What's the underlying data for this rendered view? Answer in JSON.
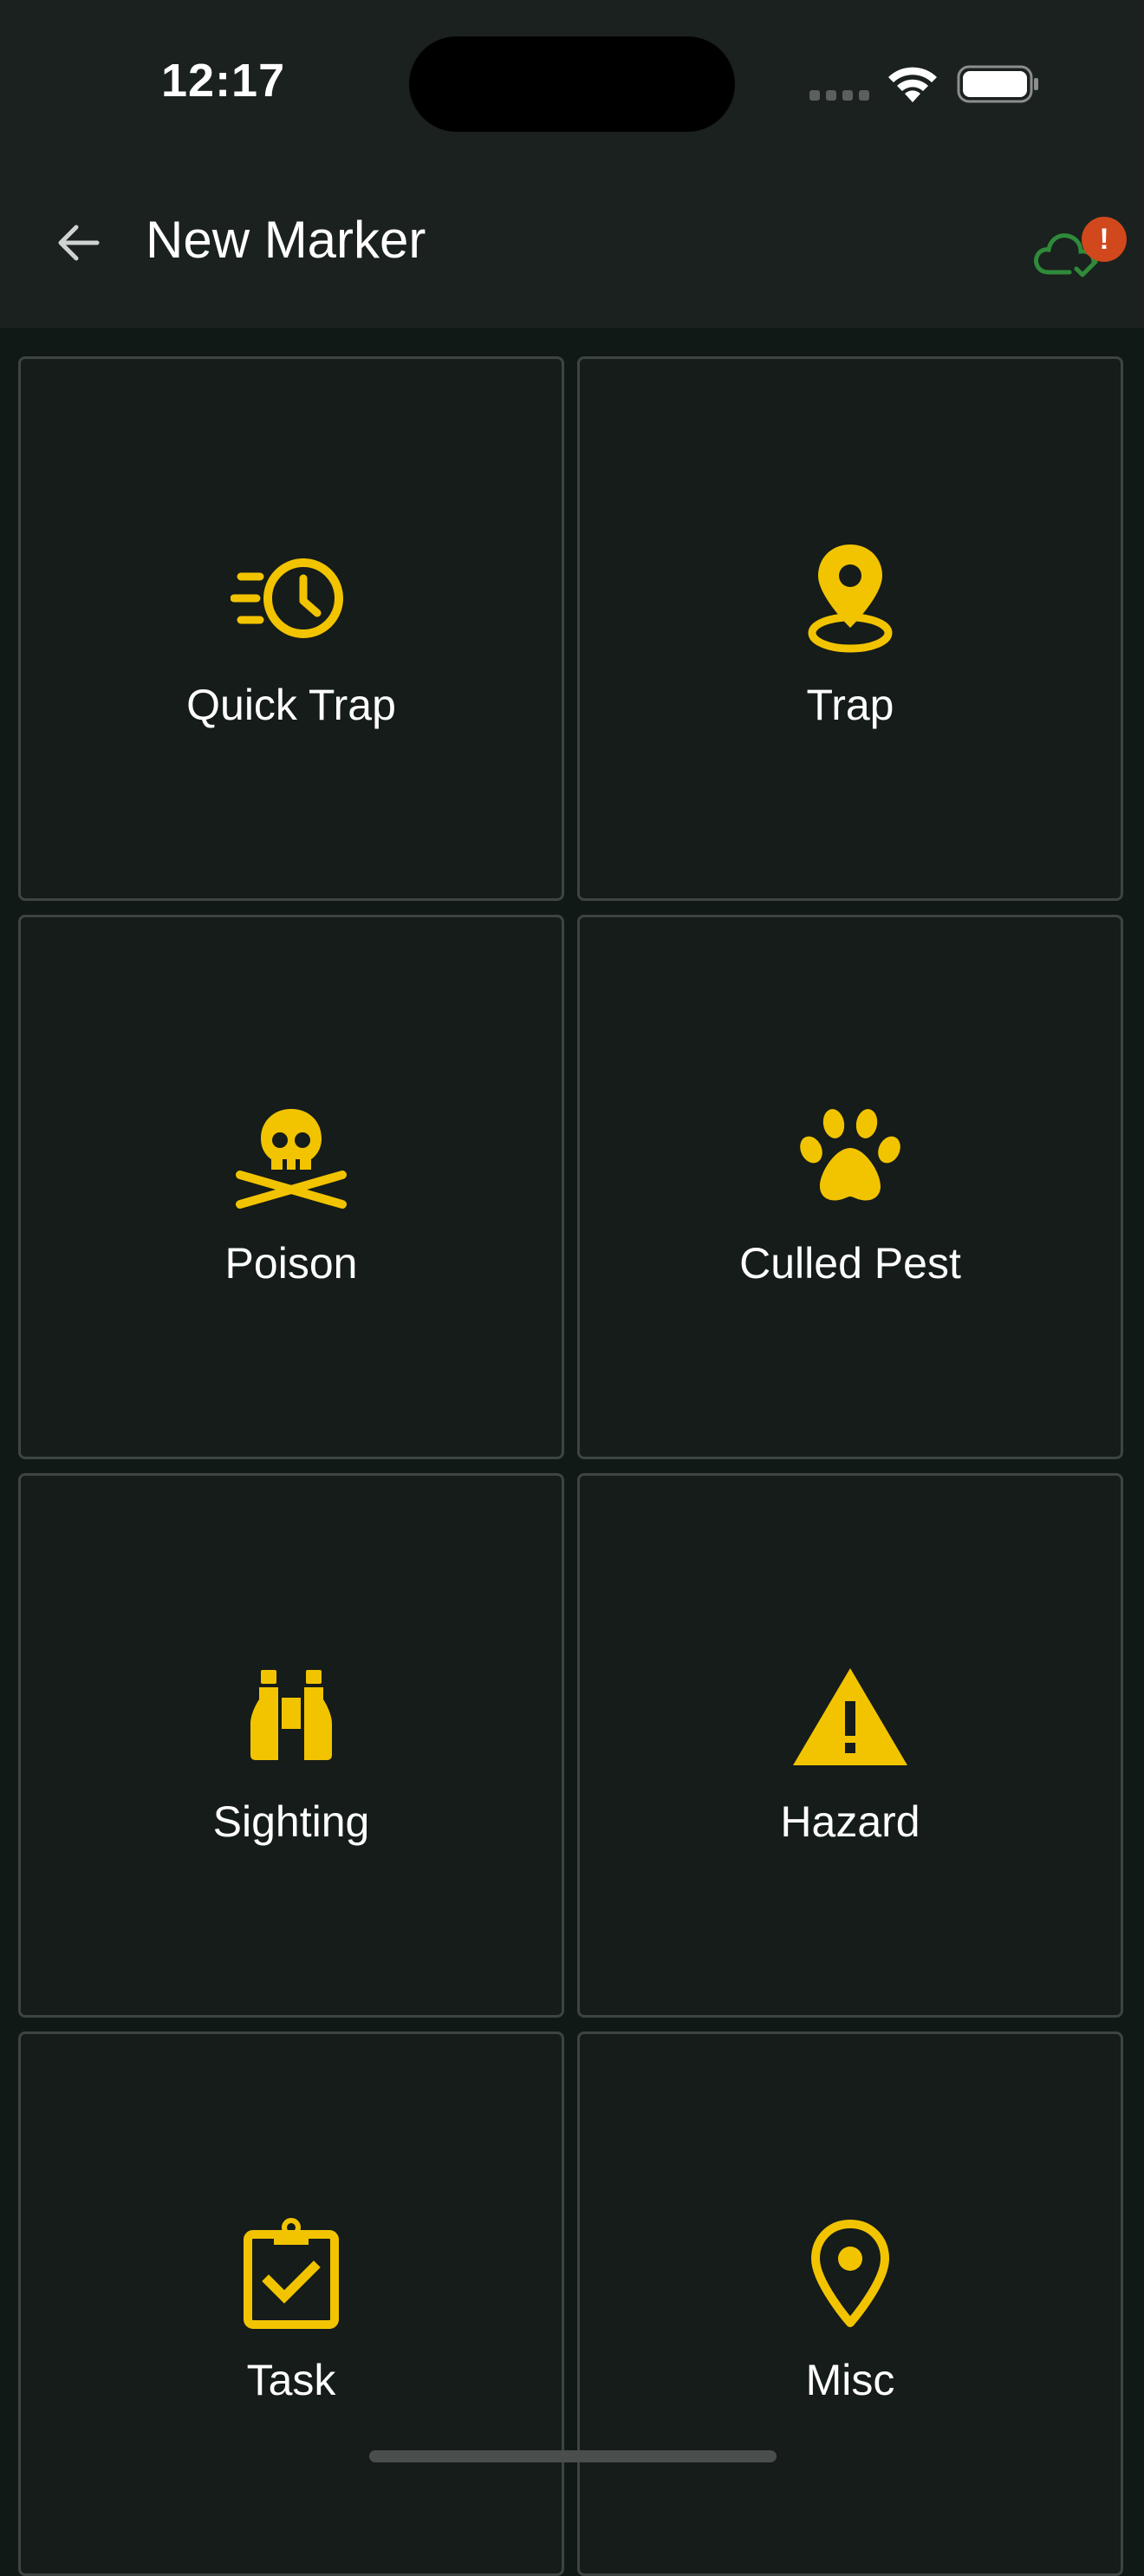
{
  "status_bar": {
    "time": "12:17"
  },
  "app_bar": {
    "title": "New Marker",
    "back_icon": "arrow-left-icon",
    "sync_icon": "cloud-check-icon",
    "sync_badge": "!"
  },
  "colors": {
    "accent": "#f2c400",
    "background": "#111916",
    "tile": "#151c19",
    "tile_border": "#3c4541",
    "app_bar": "#1a211e",
    "sync_ok": "#2f8a3a",
    "badge": "#d1481d"
  },
  "markers": [
    {
      "label": "Quick Trap",
      "icon": "timer-fast-icon"
    },
    {
      "label": "Trap",
      "icon": "map-pin-ring-icon"
    },
    {
      "label": "Poison",
      "icon": "skull-crossbones-icon"
    },
    {
      "label": "Culled Pest",
      "icon": "paw-icon"
    },
    {
      "label": "Sighting",
      "icon": "binoculars-icon"
    },
    {
      "label": "Hazard",
      "icon": "warning-triangle-icon"
    },
    {
      "label": "Task",
      "icon": "clipboard-check-icon"
    },
    {
      "label": "Misc",
      "icon": "map-pin-outline-icon"
    }
  ]
}
